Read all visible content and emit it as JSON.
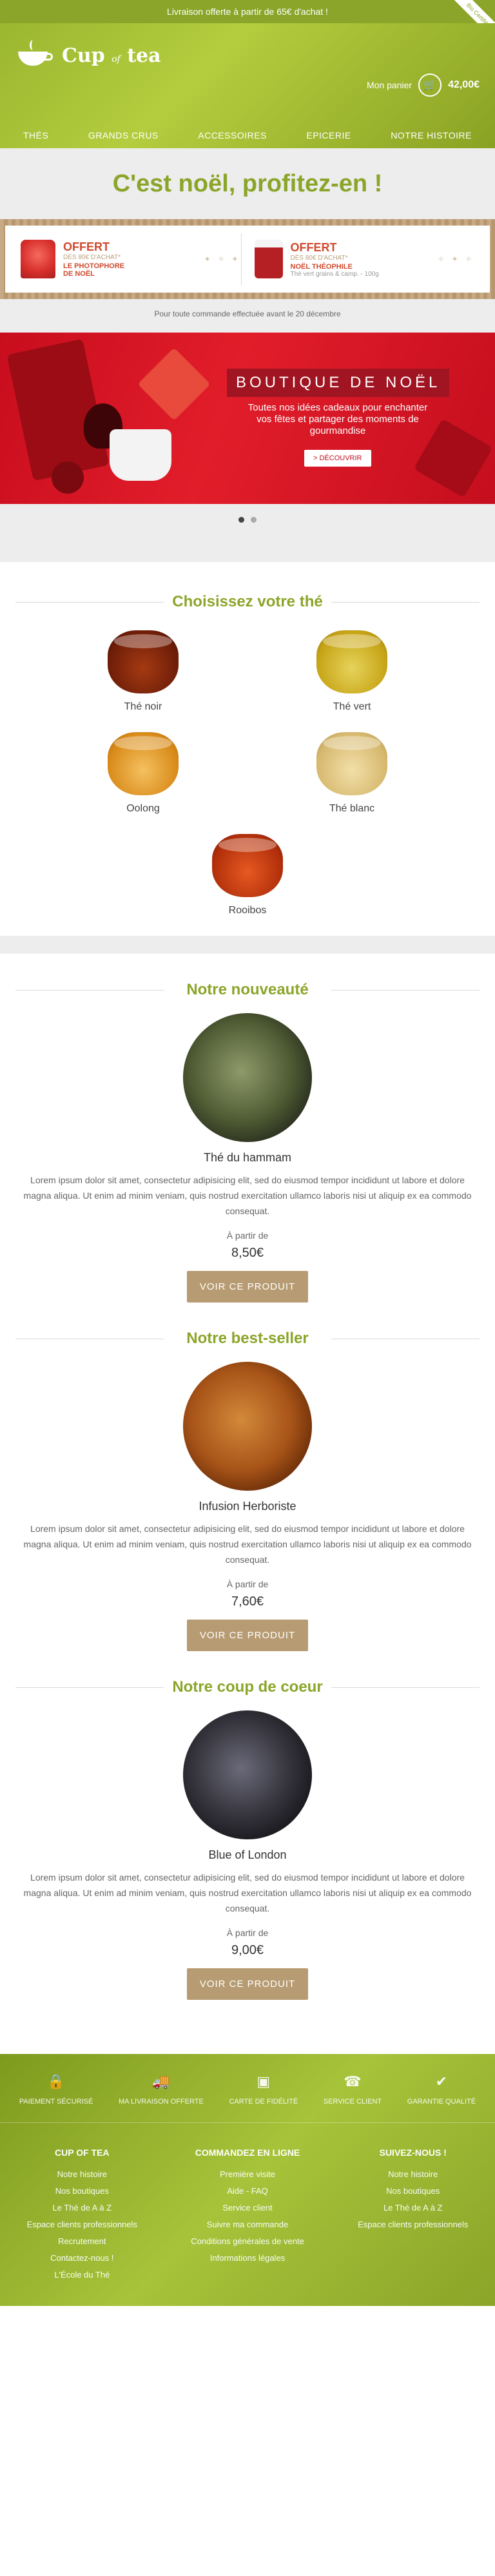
{
  "topbar": {
    "text": "Livraison offerte à partir de 65€ d'achat !",
    "ribbon": "Bio Certifié"
  },
  "header": {
    "logo": {
      "name_a": "Cup",
      "name_of": "of",
      "name_b": "tea"
    },
    "cart": {
      "label": "Mon panier",
      "total": "42,00€"
    },
    "nav": [
      "THÉS",
      "GRANDS CRUS",
      "ACCESSOIRES",
      "EPICERIE",
      "NOTRE HISTOIRE"
    ]
  },
  "hero": {
    "title": "C'est noël, profitez-en !"
  },
  "offers": [
    {
      "title": "OFFERT",
      "sub": "DÈS 80€ D'ACHAT*",
      "name": "LE PHOTOPHORE\nDE NOËL",
      "detail": ""
    },
    {
      "title": "OFFERT",
      "sub": "DÈS 80€ D'ACHAT*",
      "name": "NOËL THÉOPHILE",
      "detail": "Thé vert grains & camp. - 100g"
    }
  ],
  "notice": "Pour toute commande effectuée avant le 20 décembre",
  "banner": {
    "title": "BOUTIQUE DE NOËL",
    "subtitle": "Toutes nos idées cadeaux pour enchanter vos fêtes et partager des moments de gourmandise",
    "button": "> DÉCOUVRIR"
  },
  "themes_section": {
    "title": "Choisissez votre thé",
    "items": [
      "Thé noir",
      "Thé vert",
      "Oolong",
      "Thé blanc",
      "Rooibos"
    ]
  },
  "products": [
    {
      "section_title": "Notre nouveauté",
      "name": "Thé du hammam",
      "description": "Lorem ipsum dolor sit amet, consectetur adipisicing elit, sed do eiusmod tempor incididunt ut labore et dolore magna aliqua. Ut enim ad minim veniam, quis nostrud exercitation ullamco laboris nisi ut aliquip ex ea commodo consequat.",
      "from": "À partir de",
      "price": "8,50€",
      "button": "VOIR CE PRODUIT"
    },
    {
      "section_title": "Notre best-seller",
      "name": "Infusion Herboriste",
      "description": "Lorem ipsum dolor sit amet, consectetur adipisicing elit, sed do eiusmod tempor incididunt ut labore et dolore magna aliqua. Ut enim ad minim veniam, quis nostrud exercitation ullamco laboris nisi ut aliquip ex ea commodo consequat.",
      "from": "À partir de",
      "price": "7,60€",
      "button": "VOIR CE PRODUIT"
    },
    {
      "section_title": "Notre coup de coeur",
      "name": "Blue of London",
      "description": "Lorem ipsum dolor sit amet, consectetur adipisicing elit, sed do eiusmod tempor incididunt ut labore et dolore magna aliqua. Ut enim ad minim veniam, quis nostrud exercitation ullamco laboris nisi ut aliquip ex ea commodo consequat.",
      "from": "À partir de",
      "price": "9,00€",
      "button": "VOIR CE PRODUIT"
    }
  ],
  "footer": {
    "reassurance": [
      {
        "icon": "lock-icon",
        "label": "PAIEMENT SÉCURISÉ"
      },
      {
        "icon": "truck-icon",
        "label": "MA LIVRAISON OFFERTE"
      },
      {
        "icon": "card-icon",
        "label": "CARTE DE FIDÉLITÉ"
      },
      {
        "icon": "phone-icon",
        "label": "SERVICE CLIENT"
      },
      {
        "icon": "check-icon",
        "label": "GARANTIE QUALITÉ"
      }
    ],
    "columns": [
      {
        "title": "CUP OF TEA",
        "links": [
          "Notre histoire",
          "Nos boutiques",
          "Le Thé de A à Z",
          "Espace clients professionnels",
          "Recrutement",
          "Contactez-nous !",
          "L'École du Thé"
        ]
      },
      {
        "title": "COMMANDEZ EN LIGNE",
        "links": [
          "Première visite",
          "Aide - FAQ",
          "Service client",
          "Suivre ma commande",
          "Conditions générales de vente",
          "Informations légales"
        ]
      },
      {
        "title": "SUIVEZ-NOUS !",
        "links": [
          "Notre histoire",
          "Nos boutiques",
          "Le Thé de A à Z",
          "Espace clients professionnels"
        ]
      }
    ]
  },
  "colors": {
    "accent_green": "#8ba52a",
    "button_tan": "#b79b72",
    "banner_red": "#e21d2a"
  }
}
